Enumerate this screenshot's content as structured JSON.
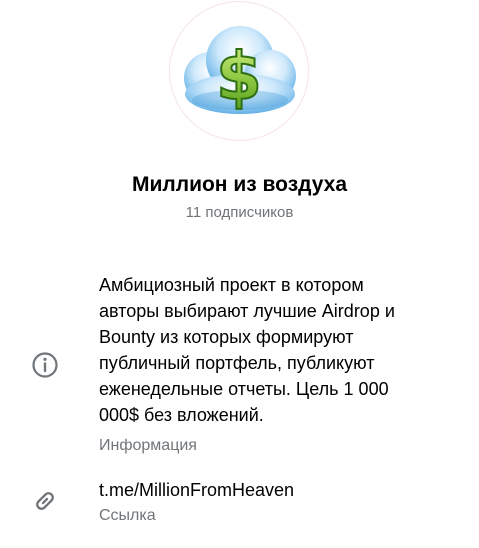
{
  "channel": {
    "name": "Миллион из воздуха",
    "subscribers": "11 подписчиков",
    "avatar_icon": "dollar-cloud-icon"
  },
  "info": {
    "description": "Амбициозный проект в котором\nавторы выбирают лучшие Airdrop и\nBounty из которых формируют\nпубличный портфель, публикуют\nеженедельные отчеты. Цель 1 000\n000$ без вложений.",
    "label": "Информация",
    "icon": "info-icon"
  },
  "link": {
    "url": "t.me/MillionFromHeaven",
    "label": "Ссылка",
    "icon": "link-icon"
  },
  "colors": {
    "secondary_text": "#707579",
    "icon_gray": "#707579",
    "cloud_blue": "#5aaee6",
    "dollar_green": "#8cc63f"
  }
}
